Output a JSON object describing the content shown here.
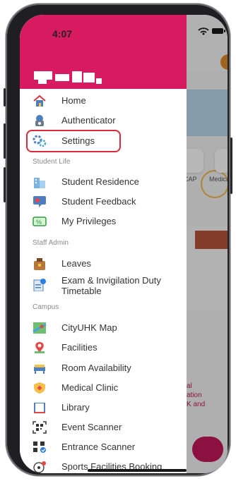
{
  "status_bar": {
    "time": "4:07"
  },
  "drawer": {
    "items": [
      {
        "label": "Home",
        "icon": "home-icon"
      },
      {
        "label": "Authenticator",
        "icon": "authenticator-icon"
      },
      {
        "label": "Settings",
        "icon": "settings-icon"
      }
    ],
    "sections": [
      {
        "title": "Student Life",
        "items": [
          {
            "label": "Student Residence",
            "icon": "residence-icon"
          },
          {
            "label": "Student Feedback",
            "icon": "feedback-icon"
          },
          {
            "label": "My Privileges",
            "icon": "privileges-icon"
          }
        ]
      },
      {
        "title": "Staff Admin",
        "items": [
          {
            "label": "Leaves",
            "icon": "leaves-icon"
          },
          {
            "label": "Exam & Invigilation Duty",
            "label2": "Timetable",
            "icon": "exam-icon"
          }
        ]
      },
      {
        "title": "Campus",
        "items": [
          {
            "label": "CityUHK Map",
            "icon": "map-icon"
          },
          {
            "label": "Facilities",
            "icon": "facilities-icon"
          },
          {
            "label": "Room Availability",
            "icon": "room-icon"
          },
          {
            "label": "Medical Clinic",
            "icon": "medical-icon"
          },
          {
            "label": "Library",
            "icon": "library-icon"
          },
          {
            "label": "Event Scanner",
            "icon": "qr-scan-icon"
          },
          {
            "label": "Entrance Scanner",
            "icon": "entrance-scan-icon"
          },
          {
            "label": "Sports Facilities Booking",
            "icon": "sports-icon"
          }
        ]
      }
    ]
  },
  "background": {
    "tile_labels": [
      "CAP",
      "Medica"
    ],
    "red_text": [
      "al",
      "ation",
      "K and"
    ]
  },
  "colors": {
    "header": "#d81b60",
    "highlight": "#e0273d"
  }
}
